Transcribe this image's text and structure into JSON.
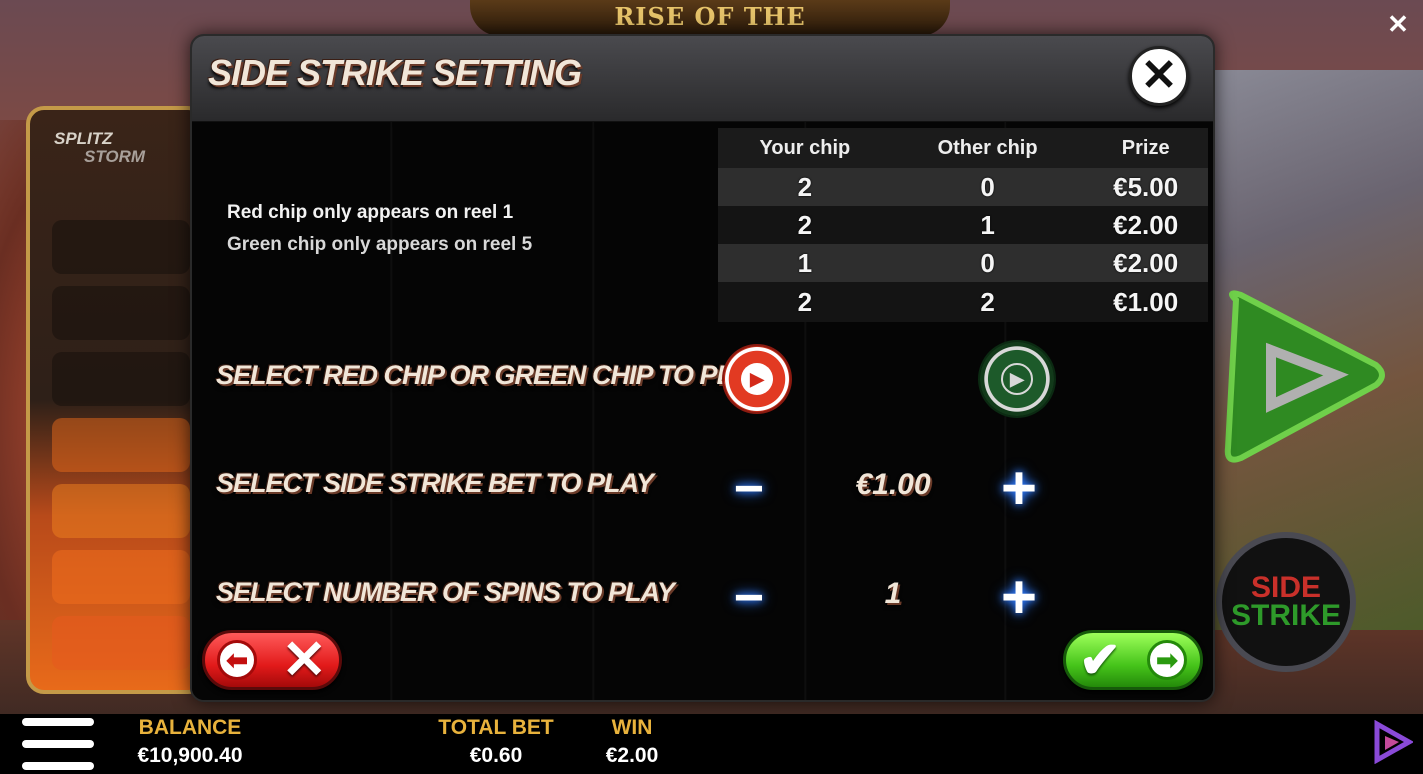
{
  "game": {
    "title": "RISE OF THE"
  },
  "splitz": {
    "logo_line1": "SPLITZ",
    "logo_line2": "STORM"
  },
  "side_strike_badge": {
    "line1": "SIDE",
    "line2": "STRIKE"
  },
  "modal": {
    "title": "SIDE STRIKE SETTING",
    "info": [
      "Red chip only appears on reel 1",
      "Green chip only appears on reel 5"
    ],
    "table": {
      "headers": [
        "Your chip",
        "Other chip",
        "Prize"
      ],
      "rows": [
        [
          "2",
          "0",
          "€5.00"
        ],
        [
          "2",
          "1",
          "€2.00"
        ],
        [
          "1",
          "0",
          "€2.00"
        ],
        [
          "2",
          "2",
          "€1.00"
        ]
      ]
    },
    "chip_row_label": "SELECT RED CHIP OR GREEN CHIP TO PLAY",
    "bet_row_label": "SELECT SIDE STRIKE BET TO PLAY",
    "bet_value": "€1.00",
    "spins_row_label": "SELECT NUMBER OF SPINS TO PLAY",
    "spins_value": "1",
    "minus_symbol": "−",
    "plus_symbol": "+"
  },
  "bottom_bar": {
    "balance_label": "BALANCE",
    "balance_value": "€10,900.40",
    "total_bet_label": "TOTAL BET",
    "total_bet_value": "€0.60",
    "win_label": "WIN",
    "win_value": "€2.00"
  },
  "colors": {
    "accent_gold": "#e8b23c",
    "red_chip": "#e23a22",
    "green_chip": "#1d5a2a",
    "stepper_glow": "#2f7bff"
  }
}
